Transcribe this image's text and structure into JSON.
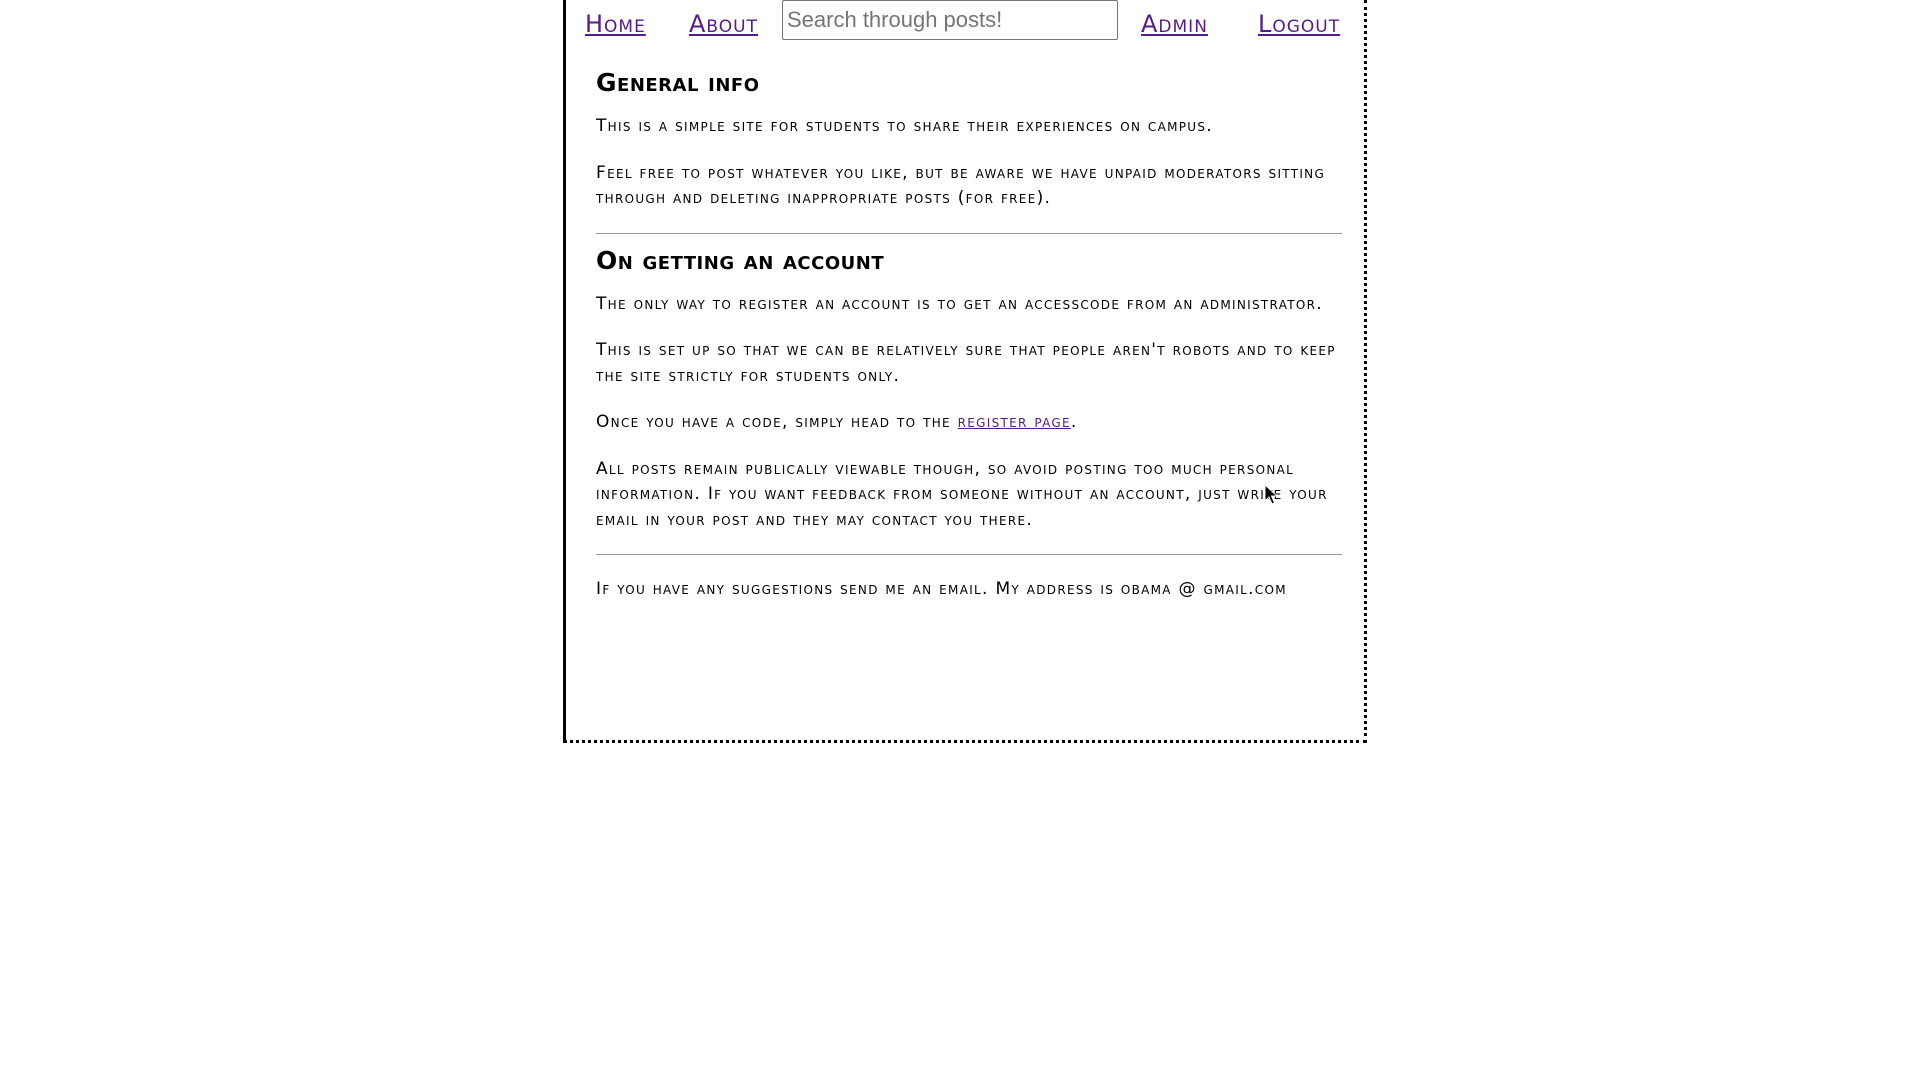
{
  "nav": {
    "home": "Home",
    "about": "About",
    "search_placeholder": "Search through posts!",
    "admin": "Admin",
    "logout": "Logout"
  },
  "sections": {
    "general": {
      "heading": "General info",
      "p1": "This is a simple site for students to share their experiences on campus.",
      "p2": "Feel free to post whatever you like, but be aware we have unpaid moderators sitting through and deleting inappropriate posts (for free)."
    },
    "account": {
      "heading": "On getting an account",
      "p1": "The only way to register an account is to get an accesscode from an administrator.",
      "p2": "This is set up so that we can be relatively sure that people aren't robots and to keep the site strictly for students only.",
      "p3_before": "Once you have a code, simply head to the ",
      "p3_link": "register page",
      "p3_after": ".",
      "p4": "All posts remain publically viewable though, so avoid posting too much personal information. If you want feedback from someone without an account, just write your email in your post and they may contact you there."
    },
    "footer": {
      "text": "If you have any suggestions send me an email. My address is obama @ gmail.com"
    }
  },
  "colors": {
    "link": "#551a8b",
    "text": "#000000",
    "divider": "#9a9a9a"
  },
  "icons": {
    "cursor": "mouse-pointer-icon"
  }
}
